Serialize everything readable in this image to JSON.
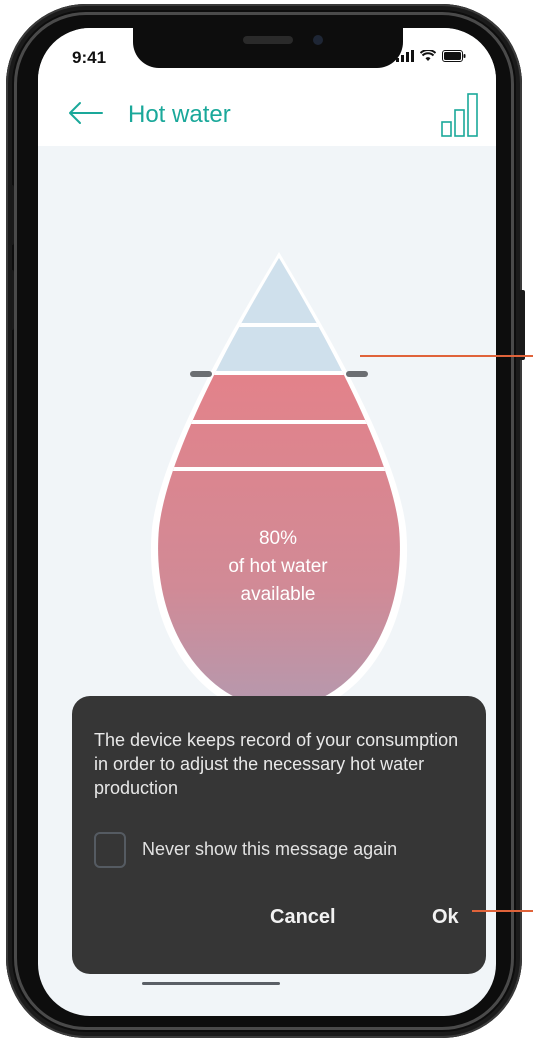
{
  "status_bar": {
    "time": "9:41"
  },
  "header": {
    "title": "Hot water",
    "back_icon": "arrow-left-icon",
    "chart_icon": "signal-bars-icon"
  },
  "gauge": {
    "percent_value": "80%",
    "line2": "of hot water",
    "line3": "available",
    "level_fraction": 0.8,
    "colors": {
      "empty_segment": "#cfe0ec",
      "filled_top": "#e3828a",
      "filled_bottom": "#b39ab0",
      "outline": "#ffffff",
      "tick": "#6b6e72"
    }
  },
  "dialog": {
    "message": "The device keeps record of your consumption in order to adjust the necessary hot water production",
    "checkbox_label": "Never show this message again",
    "checkbox_checked": false,
    "cancel_label": "Cancel",
    "ok_label": "Ok"
  },
  "colors": {
    "accent": "#1aa89a",
    "dialog_bg": "#363636",
    "callout": "#e0633a",
    "screen_bg": "#f1f5f8"
  }
}
